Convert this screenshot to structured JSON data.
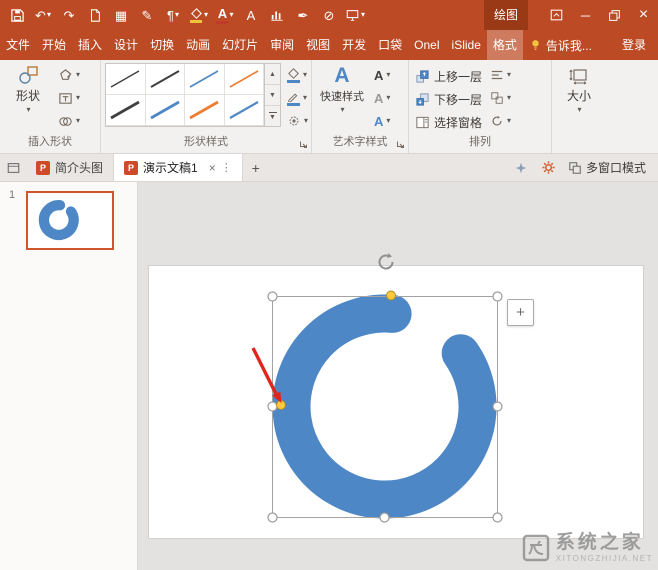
{
  "titlebar": {
    "context_tab_group": "绘图",
    "fill_bar_style": "background:#F0C33C",
    "font_bar_style": "background:#C0392B"
  },
  "icons": {
    "caret": "▾",
    "undo": "↶",
    "redo": "↷",
    "paragraph": "¶",
    "close": "×",
    "more": "⋮",
    "up": "▲",
    "down": "▼",
    "minimize": "─",
    "slash": "⊘",
    "pencil": "✎",
    "ink": "✒",
    "table": "▦",
    "plus": "+",
    "letter_a": "A"
  },
  "tabs": [
    "文件",
    "开始",
    "插入",
    "设计",
    "切换",
    "动画",
    "幻灯片",
    "审阅",
    "视图",
    "开发",
    "口袋",
    "Onel",
    "iSlide",
    "格式"
  ],
  "tell_me": "告诉我...",
  "sign_in": "登录",
  "ribbon": {
    "insert_shapes": {
      "group_label": "插入形状",
      "shapes_label": "形状"
    },
    "shape_styles": {
      "group_label": "形状样式",
      "fill_bar_style": "background:#4E87C5",
      "outline_bar_style": "background:#4E87C5",
      "styles": [
        "color:#3F3F3F",
        "color:#3F3F3F",
        "color:#4E87C5",
        "color:#ED7D31",
        "color:#3F3F3F",
        "color:#4E87C5",
        "color:#ED7D31",
        "color:#4E87C5"
      ]
    },
    "wordart": {
      "group_label": "艺术字样式",
      "quick_styles_label": "快速样式",
      "a_styles": [
        "color:#3F3F3F",
        "color:#9A9A9A",
        "color:#4E87C5"
      ]
    },
    "arrange": {
      "group_label": "排列",
      "bring_forward": "上移一层",
      "send_backward": "下移一层",
      "selection_pane": "选择窗格"
    },
    "size": {
      "label": "大小"
    }
  },
  "docbar": {
    "file_badge": "P",
    "tabs": [
      {
        "title": "简介头图"
      },
      {
        "title": "演示文稿1"
      }
    ],
    "multi_window": "多窗口模式"
  },
  "slides_panel": {
    "slide_number": "1"
  },
  "canvas": {
    "shape_color": "color:#4E87C5",
    "arrow_color": "color:#E0261C"
  },
  "watermark": {
    "title": "系统之家",
    "subtitle": "XITONGZHIJIA.NET"
  }
}
